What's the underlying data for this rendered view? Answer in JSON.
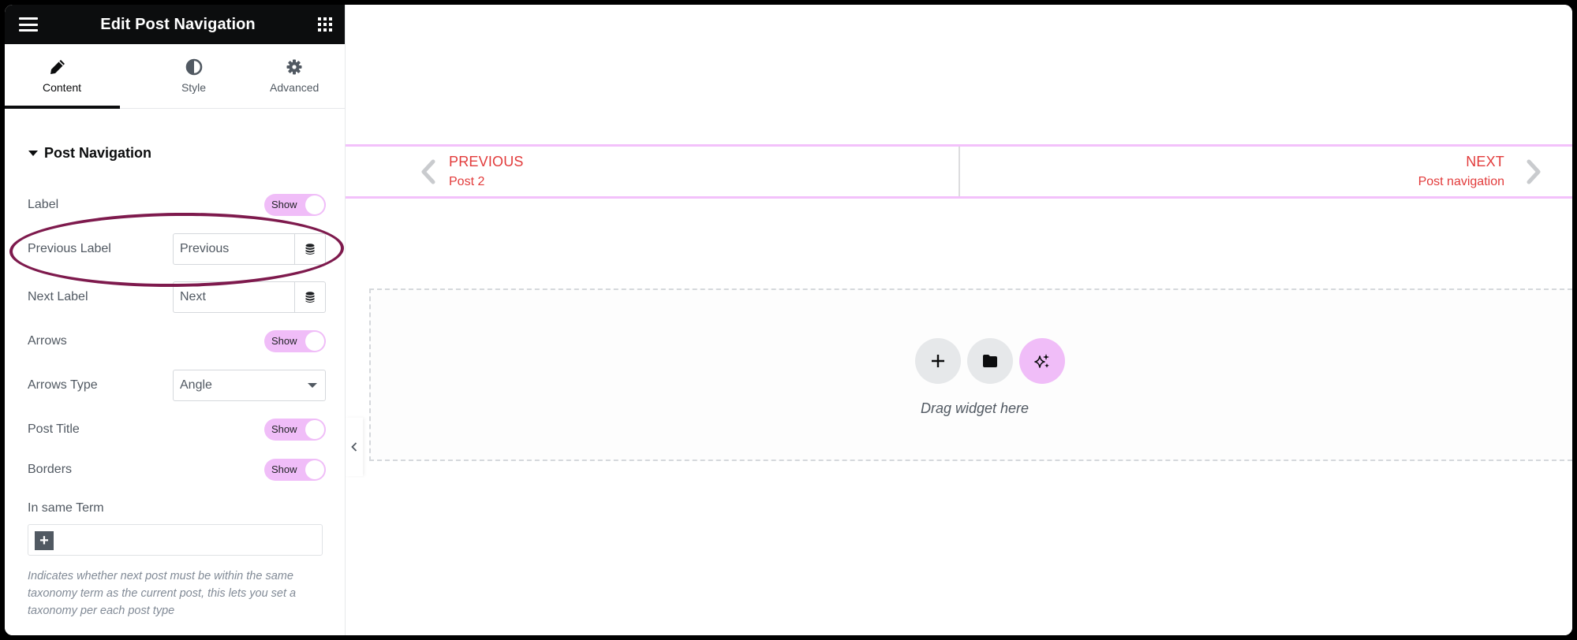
{
  "panel": {
    "title": "Edit Post Navigation",
    "menu_icon": "hamburger-icon",
    "widgets_icon": "grid-icon"
  },
  "tabs": [
    {
      "label": "Content",
      "icon": "pencil-icon",
      "active": true
    },
    {
      "label": "Style",
      "icon": "half-circle-icon",
      "active": false
    },
    {
      "label": "Advanced",
      "icon": "gear-icon",
      "active": false
    }
  ],
  "section": {
    "title": "Post Navigation",
    "expanded": true
  },
  "controls": {
    "label": {
      "label": "Label",
      "toggle": "Show",
      "on": true
    },
    "previous_label": {
      "label": "Previous Label",
      "value": "Previous"
    },
    "next_label": {
      "label": "Next Label",
      "value": "Next"
    },
    "arrows": {
      "label": "Arrows",
      "toggle": "Show",
      "on": true
    },
    "arrows_type": {
      "label": "Arrows Type",
      "value": "Angle"
    },
    "post_title": {
      "label": "Post Title",
      "toggle": "Show",
      "on": true
    },
    "borders": {
      "label": "Borders",
      "toggle": "Show",
      "on": true
    },
    "in_same_term": {
      "label": "In same Term",
      "add_label": "+",
      "help": "Indicates whether next post must be within the same taxonomy term as the current post, this lets you set a taxonomy per each post type"
    }
  },
  "preview": {
    "previous": {
      "label": "PREVIOUS",
      "title": "Post 2"
    },
    "next": {
      "label": "NEXT",
      "title": "Post navigation"
    },
    "dropzone_text": "Drag widget here",
    "colors": {
      "link": "#e23b3b",
      "border": "#f3c1fb",
      "accent": "#f0bdf8"
    }
  },
  "annotation": {
    "shape": "ellipse",
    "target": "previous-label-row",
    "color": "#7e1a4d"
  }
}
